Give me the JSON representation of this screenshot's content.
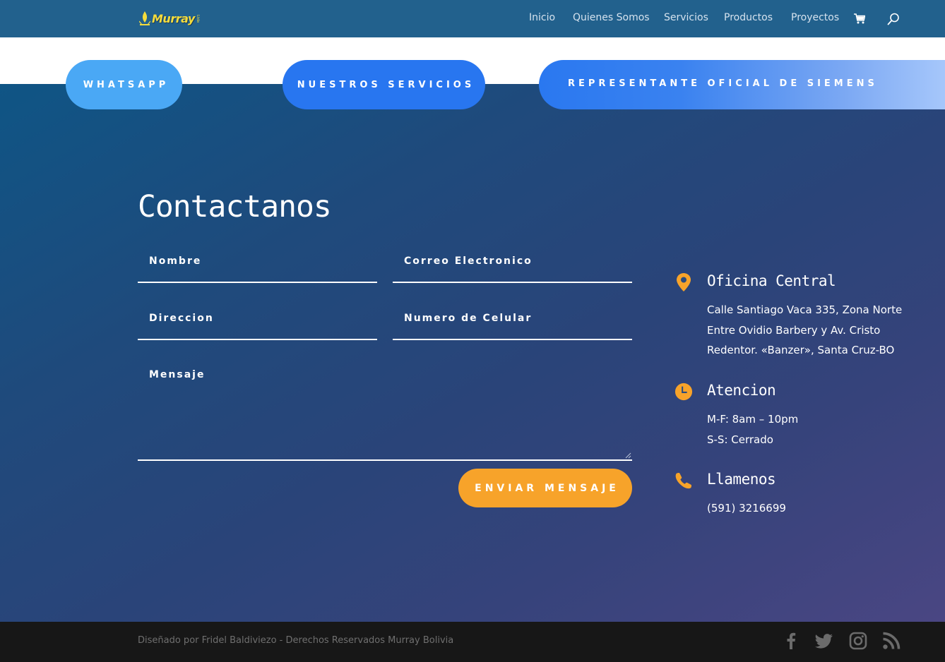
{
  "header": {
    "logo_text": "Murray",
    "logo_sub": "Ltda",
    "nav": [
      "Inicio",
      "Quienes Somos",
      "Servicios",
      "Productos",
      "Proyectos"
    ]
  },
  "buttons": {
    "whatsapp": "WHATSAPP",
    "servicios": "NUESTROS SERVICIOS",
    "siemens": "REPRESENTANTE OFICIAL DE SIEMENS"
  },
  "contact": {
    "title": "Contactanos",
    "fields": {
      "nombre": "Nombre",
      "correo": "Correo Electronico",
      "direccion": "Direccion",
      "celular": "Numero de Celular",
      "mensaje": "Mensaje"
    },
    "submit": "ENVIAR MENSAJE"
  },
  "info": {
    "office_title": "Oficina Central",
    "office_lines": [
      "Calle Santiago Vaca 335, Zona Norte",
      "Entre Ovidio Barbery y Av. Cristo",
      "Redentor. «Banzer», Santa Cruz-BO"
    ],
    "hours_title": "Atencion",
    "hours_lines": [
      "M-F: 8am – 10pm",
      "S-S: Cerrado"
    ],
    "phone_title": "Llamenos",
    "phone": "(591) 3216699"
  },
  "footer": {
    "text": "Diseñado por Fridel Baldiviezo - Derechos Reservados Murray Bolivia"
  },
  "colors": {
    "header": "#22618d",
    "accent_orange": "#f7a32a",
    "button_blue": "#2876f0",
    "button_lightblue": "#4aa8f5",
    "footer": "#171717"
  },
  "icons": [
    "shopping-cart-icon",
    "search-icon",
    "map-pin-icon",
    "clock-icon",
    "phone-icon",
    "facebook-icon",
    "twitter-icon",
    "instagram-icon",
    "rss-icon"
  ]
}
